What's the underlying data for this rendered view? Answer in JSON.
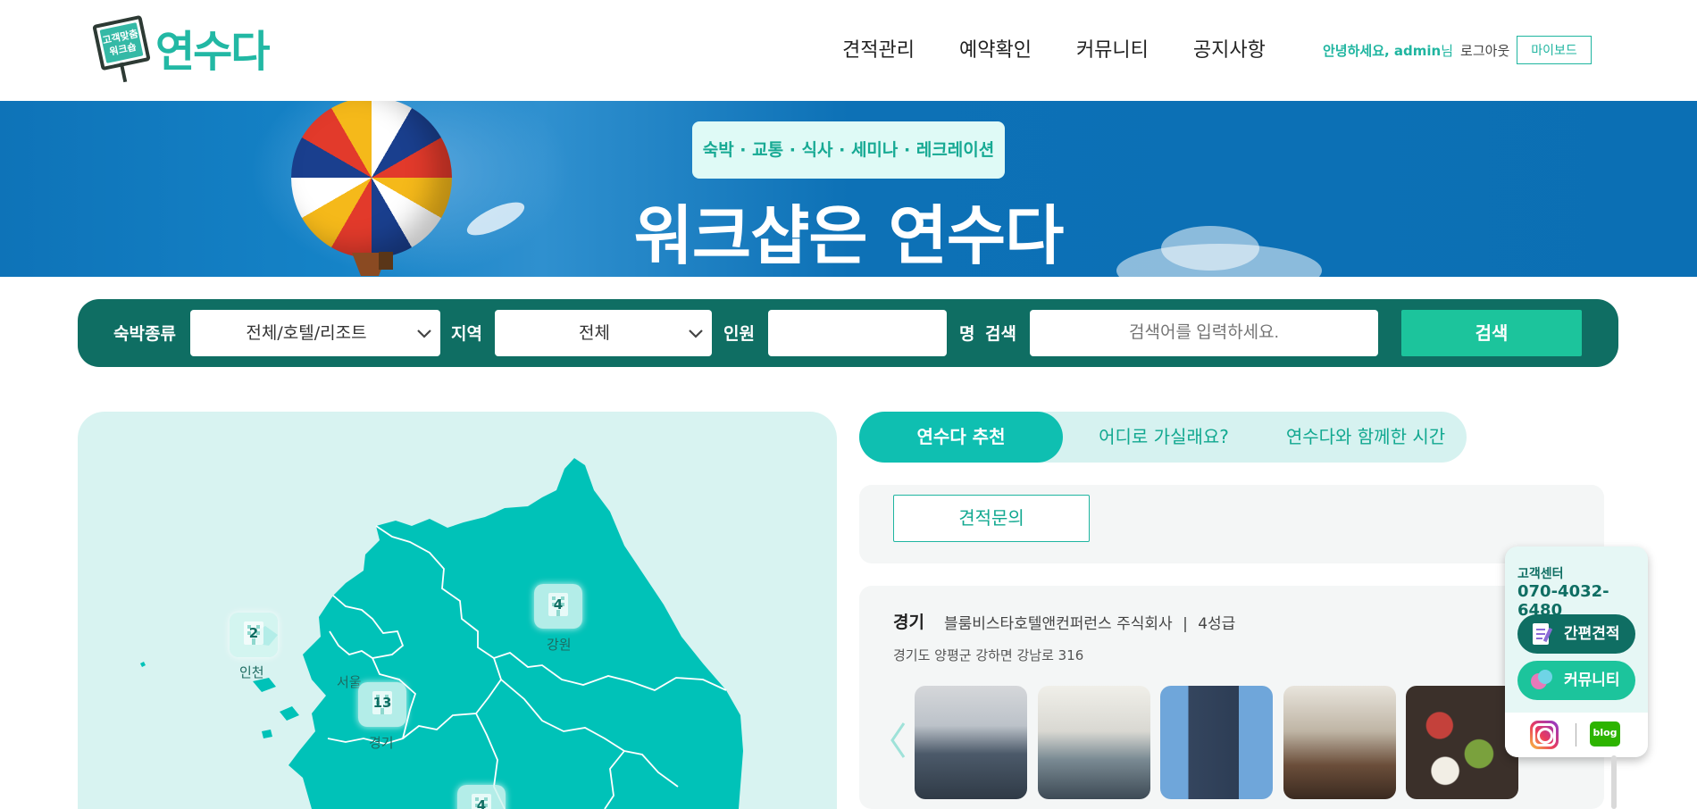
{
  "header": {
    "logo_sign": "고객맞춤\n워크숍",
    "logo_text": "연수다",
    "nav": [
      "견적관리",
      "예약확인",
      "커뮤니티",
      "공지사항"
    ],
    "greeting": "안녕하세요, admin",
    "greeting_suffix": "님",
    "logout": "로그아웃",
    "myboard": "마이보드"
  },
  "banner": {
    "tag": "숙박 · 교통 · 식사 · 세미나 · 레크레이션",
    "title": "워크샵은 연수다"
  },
  "search": {
    "type_label": "숙박종류",
    "type_value": "전체/호텔/리조트",
    "region_label": "지역",
    "region_value": "전체",
    "people_label": "인원",
    "people_value": "",
    "people_unit": "명",
    "keyword_label": "검색",
    "keyword_placeholder": "검색어를 입력하세요.",
    "button": "검색"
  },
  "map": {
    "pins": [
      {
        "region": "인천",
        "count": "2"
      },
      {
        "region": "강원",
        "count": "4"
      },
      {
        "region": "경기",
        "count": "13"
      },
      {
        "region": "",
        "count": "4"
      }
    ],
    "labels": [
      "서울"
    ]
  },
  "tabs": [
    "연수다 추천",
    "어디로 가실래요?",
    "연수다와 함께한 시간"
  ],
  "quote_button": "견적문의",
  "card": {
    "region": "경기",
    "name": "블룸비스타호텔앤컨퍼런스 주식회사",
    "separator": "|",
    "grade": "4성급",
    "address": "경기도 양평군 강하면 강남로 316",
    "thumbs": [
      "seminar-room-photo",
      "conference-room-photo",
      "hotel-building-photo",
      "restaurant-photo",
      "meal-photo"
    ]
  },
  "widget": {
    "title": "고객센터",
    "phone": "070-4032-6480",
    "quick_quote": "간편견적",
    "community": "커뮤니티",
    "blog": "blog"
  },
  "colors": {
    "accent": "#1fb5a0",
    "dark_green": "#0f6e63",
    "banner_blue": "#0b6fb4",
    "map_fill": "#00c2b8"
  }
}
